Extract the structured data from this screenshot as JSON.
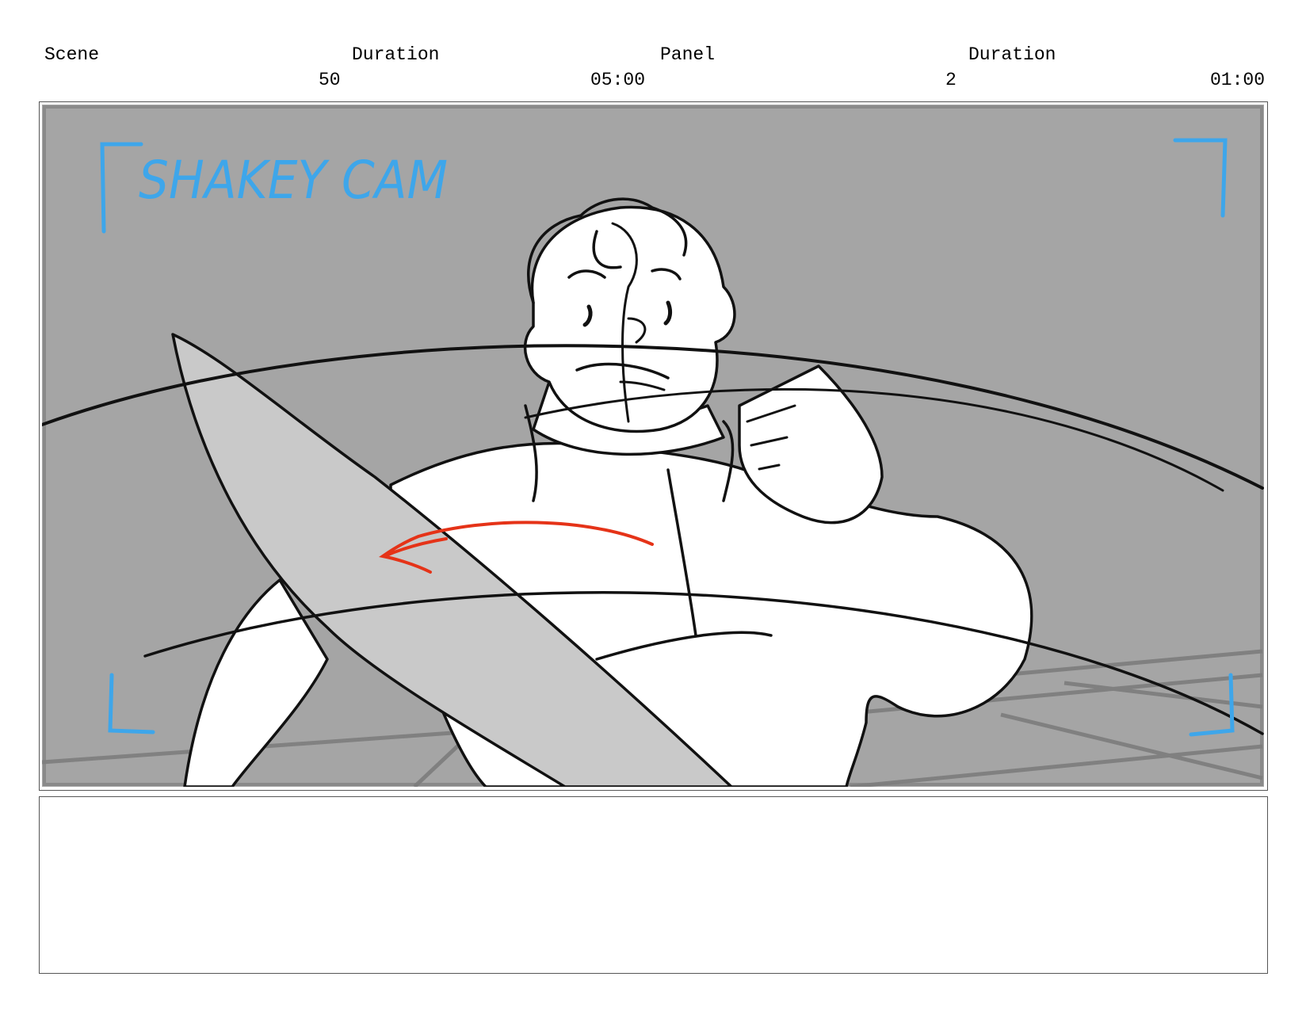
{
  "header": {
    "scene_label": "Scene",
    "scene_duration_label": "Duration",
    "panel_label": "Panel",
    "panel_duration_label": "Duration",
    "scene_value": "50",
    "scene_duration_value": "05:00",
    "panel_value": "2",
    "panel_duration_value": "01:00"
  },
  "panel_image": {
    "annotation": "SHAKEY CAM",
    "annotation_color": "#3ea6ea",
    "motion_arrow_color": "#e53318",
    "background_color": "#a5a5a5"
  },
  "notes": {
    "text": ""
  }
}
